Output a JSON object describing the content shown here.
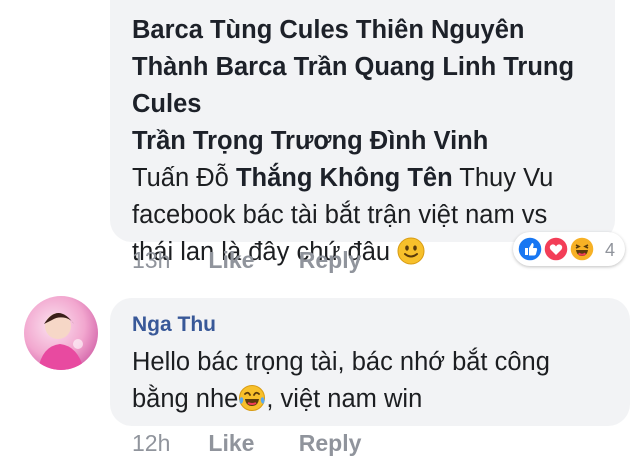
{
  "comment1": {
    "mentions": [
      "Barca Tùng",
      "Cules Thiên Nguyên",
      "Thành Barca",
      "Trần Quang Linh",
      "Trung Cules",
      "Trần Trọng",
      "Trương Đình Vinh",
      "Thắng Không Tên"
    ],
    "plain_1": "Tuấn Đỗ",
    "plain_2": "Thuy Vu",
    "text": "facebook bác tài bắt trận việt nam vs thái lan là đây chứ đâu",
    "emoji": "slightly-smiling-face",
    "time": "13h",
    "like_label": "Like",
    "reply_label": "Reply",
    "reactions": {
      "types": [
        "like",
        "love",
        "haha"
      ],
      "count": "4"
    }
  },
  "comment2": {
    "author": "Nga Thu",
    "text_1": "Hello bác trọng tài, bác nhớ bắt công",
    "text_2a": "bằng nhe",
    "emoji": "face-with-tears-of-joy",
    "text_2b": ", việt nam win",
    "time": "12h",
    "like_label": "Like",
    "reply_label": "Reply"
  },
  "colors": {
    "bubble": "#f2f3f5",
    "author": "#385898",
    "meta": "#90949c",
    "like": "#1877f2",
    "love": "#f33e58",
    "haha": "#f7b125"
  }
}
